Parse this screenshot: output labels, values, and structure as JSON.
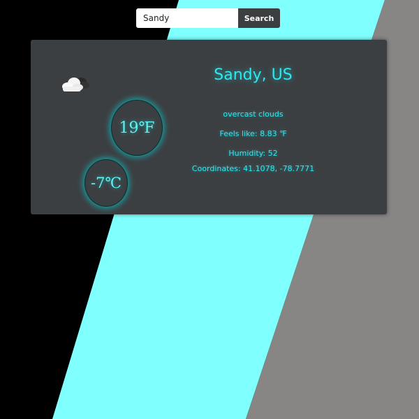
{
  "colors": {
    "background_dark": "#000000",
    "stripe_cyan": "#80ffff",
    "stripe_gray": "#888585",
    "card_bg": "#3c3f42",
    "accent_cyan": "#2fe8f2",
    "button_bg": "#3c3f42"
  },
  "search": {
    "value": "Sandy",
    "button_label": "Search"
  },
  "weather": {
    "icon": "cloud-icon",
    "city": "Sandy, US",
    "temp_f": "19℉",
    "temp_c": "-7℃",
    "description": "overcast clouds",
    "feels_like": "Feels like: 8.83 ℉",
    "humidity": "Humidity: 52",
    "coordinates": "Coordinates: 41.1078, -78.7771"
  }
}
